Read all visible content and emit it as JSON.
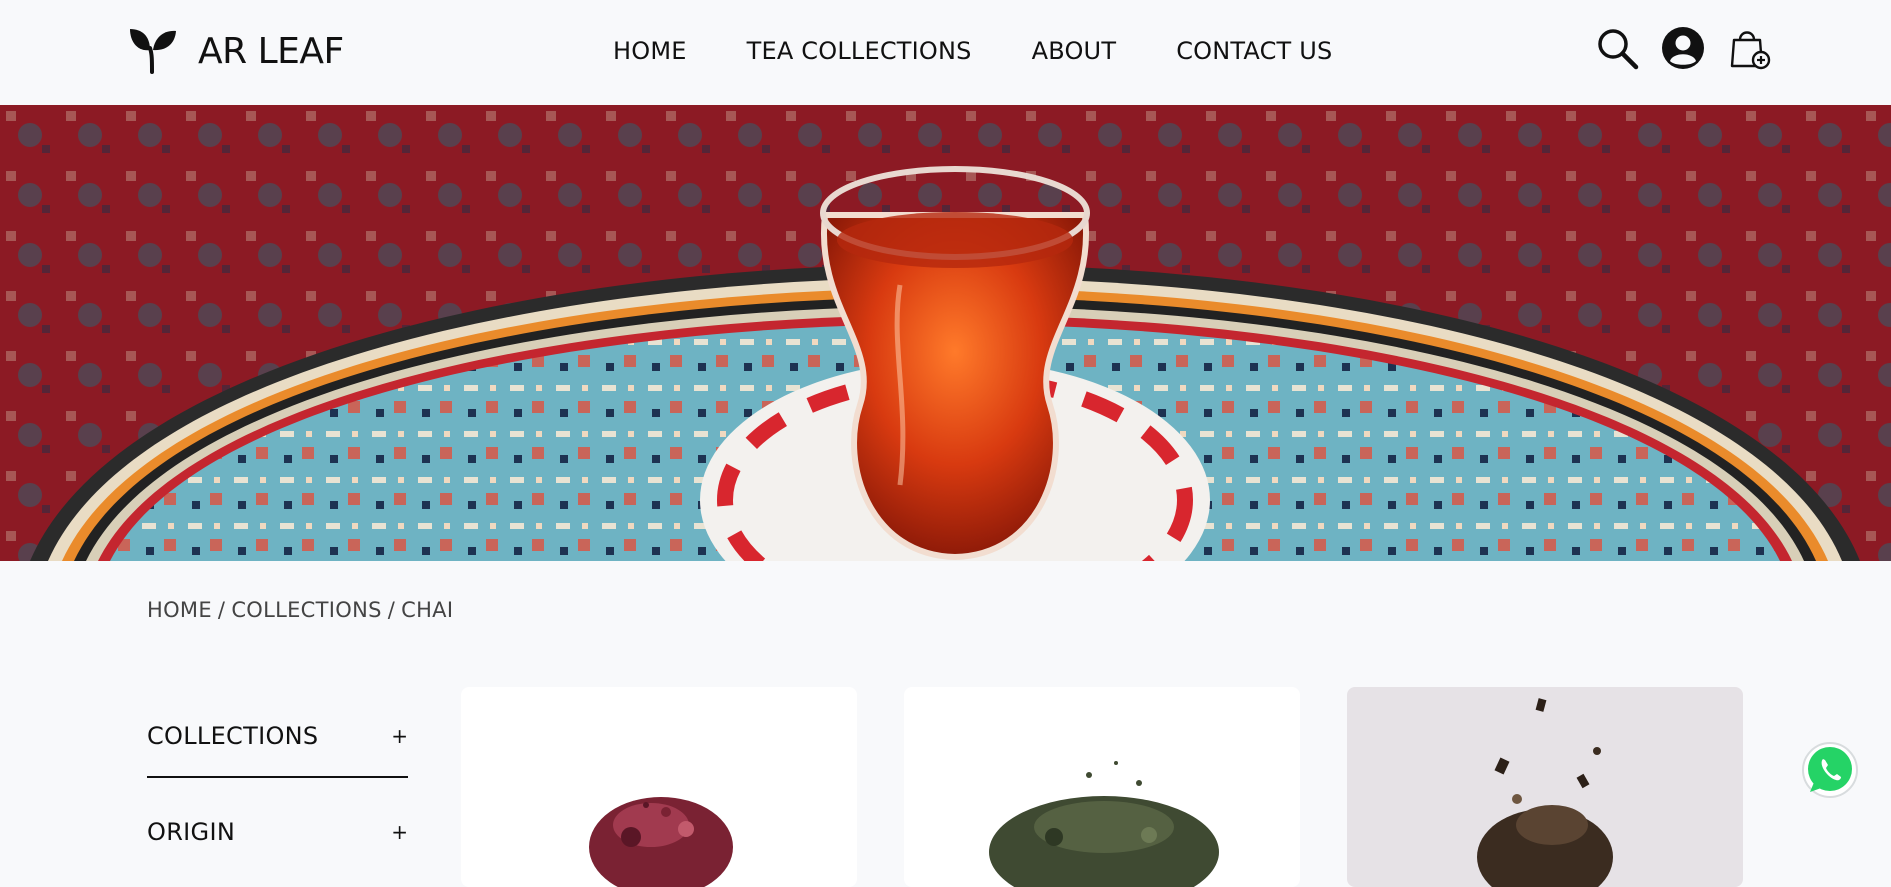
{
  "brand": {
    "name": "AR LEAF"
  },
  "nav": {
    "home": "HOME",
    "collections": "TEA COLLECTIONS",
    "about": "ABOUT",
    "contact": "CONTACT US"
  },
  "header_icons": [
    "search-icon",
    "account-icon",
    "shopping-bag-icon"
  ],
  "breadcrumb": {
    "home": "HOME",
    "sep1": "/",
    "collections": "COLLECTIONS",
    "sep2": "/",
    "current": "CHAI"
  },
  "filters": [
    {
      "label": "COLLECTIONS",
      "toggle": "+"
    },
    {
      "label": "ORIGIN",
      "toggle": "+"
    }
  ],
  "products": [
    {
      "image": "dried-hibiscus-tea-leaves"
    },
    {
      "image": "green-tea-leaves"
    },
    {
      "image": "dark-loose-leaf-tea"
    }
  ],
  "colors": {
    "background": "#f8f9fb",
    "text": "#111111",
    "card": "#ffffff",
    "card_alt": "#e6e2e6",
    "whatsapp": "#25d366"
  }
}
